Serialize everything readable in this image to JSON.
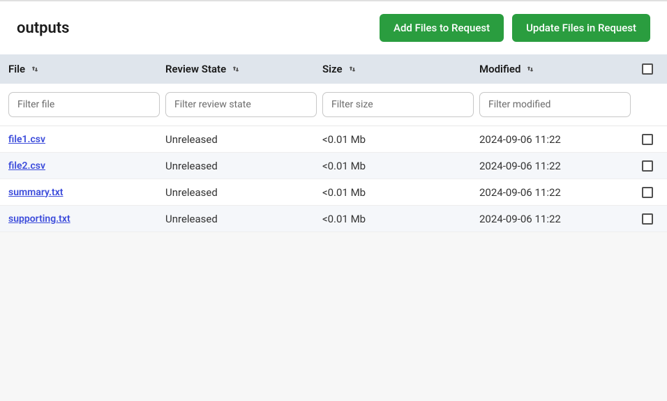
{
  "header": {
    "title": "outputs",
    "add_button": "Add Files to Request",
    "update_button": "Update Files in Request"
  },
  "columns": {
    "file": "File",
    "review_state": "Review State",
    "size": "Size",
    "modified": "Modified"
  },
  "filters": {
    "file_placeholder": "Filter file",
    "review_placeholder": "Filter review state",
    "size_placeholder": "Filter size",
    "modified_placeholder": "Filter modified"
  },
  "rows": [
    {
      "file": "file1.csv",
      "review_state": "Unreleased",
      "size": "<0.01 Mb",
      "modified": "2024-09-06 11:22"
    },
    {
      "file": "file2.csv",
      "review_state": "Unreleased",
      "size": "<0.01 Mb",
      "modified": "2024-09-06 11:22"
    },
    {
      "file": "summary.txt",
      "review_state": "Unreleased",
      "size": "<0.01 Mb",
      "modified": "2024-09-06 11:22"
    },
    {
      "file": "supporting.txt",
      "review_state": "Unreleased",
      "size": "<0.01 Mb",
      "modified": "2024-09-06 11:22"
    }
  ]
}
